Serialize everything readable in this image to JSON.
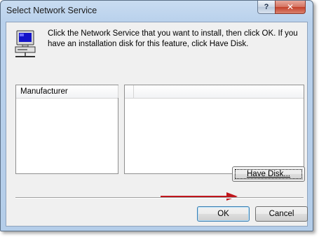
{
  "dialog": {
    "title": "Select Network Service",
    "help_glyph": "?",
    "close_glyph": "✕",
    "instructions": "Click the Network Service that you want to install, then click OK. If you have an installation disk for this feature, click Have Disk.",
    "icon": "network-computer-icon"
  },
  "manufacturer_list": {
    "header": "Manufacturer",
    "items": []
  },
  "service_list": {
    "header": "",
    "items": []
  },
  "buttons": {
    "have_disk": "Have Disk...",
    "ok": "OK",
    "cancel": "Cancel"
  },
  "annotation": {
    "arrow_color": "#c0161c"
  },
  "colors": {
    "close_button": "#c4402a",
    "window_frame": "#b9d1ec"
  }
}
